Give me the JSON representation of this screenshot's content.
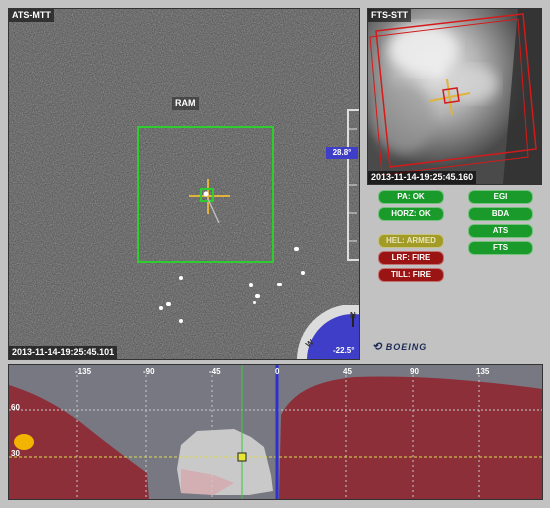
{
  "main": {
    "label": "ATS-MTT",
    "timestamp": "2013-11-14-19:25:45.101",
    "target_label": "RAM",
    "gauge_value": "28.8°",
    "heading_value": "-22.5°",
    "heading_letter_w": "W",
    "heading_letter_n": "N"
  },
  "side": {
    "label": "FTS-STT",
    "timestamp": "2013-11-14-19:25:45.160"
  },
  "status": {
    "pa": "PA: OK",
    "horz": "HORZ: OK",
    "egi": "EGI",
    "bda": "BDA",
    "ats": "ATS",
    "fts": "FTS",
    "hel": "HEL: ARMED",
    "lrf": "LRF: FIRE",
    "till": "TILL: FIRE"
  },
  "brand": "BOEING",
  "bottom": {
    "ticks": [
      "-135",
      "-90",
      "-45",
      "0",
      "45",
      "90",
      "135"
    ],
    "rows": [
      "60",
      "30"
    ]
  },
  "colors": {
    "green_box": "#2ecc2e",
    "red_zone": "#8e2b35",
    "status_green": "#1a9a2b",
    "status_red": "#9b1414",
    "status_olive": "#a39b27",
    "gauge_blue": "#3e3ec8",
    "sun": "#f2b400"
  }
}
